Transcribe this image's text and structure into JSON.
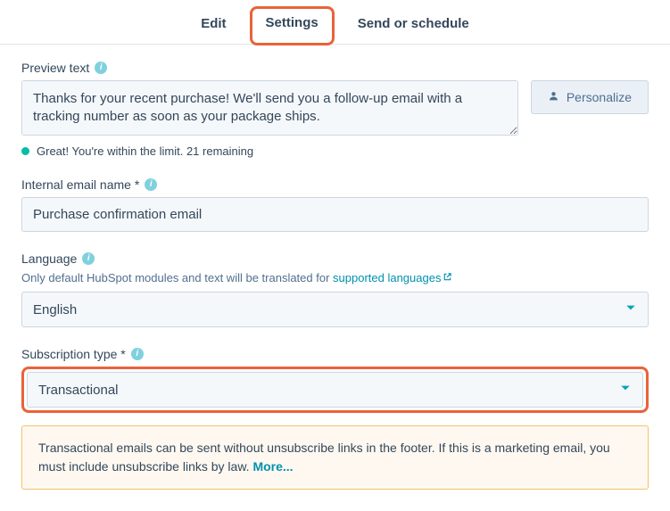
{
  "tabs": {
    "edit": "Edit",
    "settings": "Settings",
    "send": "Send or schedule"
  },
  "preview": {
    "label": "Preview text",
    "value": "Thanks for your recent purchase! We'll send you a follow-up email with a tracking number as soon as your package ships.",
    "status": "Great! You're within the limit. 21 remaining"
  },
  "personalize": {
    "label": "Personalize"
  },
  "internal_name": {
    "label": "Internal email name *",
    "value": "Purchase confirmation email"
  },
  "language": {
    "label": "Language",
    "help_prefix": "Only default HubSpot modules and text will be translated for ",
    "help_link": "supported languages",
    "value": "English"
  },
  "subscription": {
    "label": "Subscription type *",
    "value": "Transactional",
    "notice_text": "Transactional emails can be sent without unsubscribe links in the footer. If this is a marketing email, you must include unsubscribe links by law. ",
    "notice_more": "More..."
  }
}
